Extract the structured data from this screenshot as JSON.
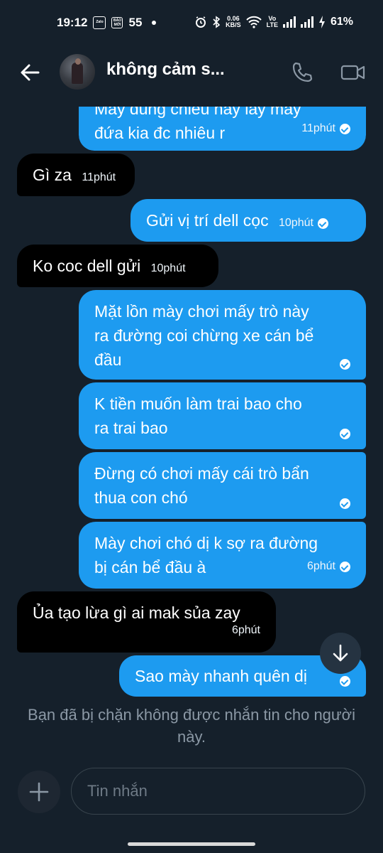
{
  "status_bar": {
    "time": "19:12",
    "app_icon_1": "Zalo",
    "app_icon_2": "BÁO MỚI",
    "notification_count": "55",
    "net_speed_value": "0.06",
    "net_speed_unit": "KB/S",
    "volte_top": "Vo",
    "volte_bottom": "LTE",
    "battery": "61%",
    "icons": [
      "alarm-icon",
      "bluetooth-icon",
      "wifi-icon",
      "signal-icon",
      "charging-icon"
    ]
  },
  "header": {
    "contact_name": "không cảm s...",
    "icons": [
      "back-arrow-icon",
      "phone-icon",
      "video-icon"
    ]
  },
  "messages": [
    {
      "direction": "out",
      "text": "Mày dùng chiêu này lấy mấy\nđứa kia đc nhiêu r",
      "time": "11phút",
      "read": true
    },
    {
      "direction": "in",
      "text": "Gì za",
      "time": "11phút"
    },
    {
      "direction": "out",
      "text": "Gửi vị trí dell cọc",
      "time": "10phút",
      "read": true
    },
    {
      "direction": "in",
      "text": "Ko coc dell gửi",
      "time": "10phút"
    },
    {
      "direction": "out",
      "text": "Mặt lồn mày chơi mấy trò này\nra đường coi chừng xe cán bể\nđầu",
      "time": "",
      "read": true
    },
    {
      "direction": "out",
      "text": "K tiền muốn làm trai bao cho\nra trai bao",
      "time": "",
      "read": true
    },
    {
      "direction": "out",
      "text": "Đừng có chơi mấy cái trò bẩn\nthua con chó",
      "time": "",
      "read": true
    },
    {
      "direction": "out",
      "text": "Mày chơi chó dị k sợ ra đường\nbị cán bể đầu à",
      "time": "6phút",
      "read": true
    },
    {
      "direction": "in",
      "text": "Ủa tạo lừa gì ai mak sủa zay",
      "time": "6phút"
    },
    {
      "direction": "out",
      "text": "Sao mày nhanh quên dị",
      "time": "",
      "read": true
    }
  ],
  "blocked_notice": "Bạn đã bị chặn không được nhắn tin cho người này.",
  "composer": {
    "placeholder": "Tin nhắn",
    "add_icon": "plus-icon"
  },
  "scroll_button_icon": "arrow-down-icon",
  "colors": {
    "background": "#15202b",
    "outgoing_bubble": "#1d9bf0",
    "incoming_bubble": "#000000",
    "muted_text": "#8b98a5"
  }
}
